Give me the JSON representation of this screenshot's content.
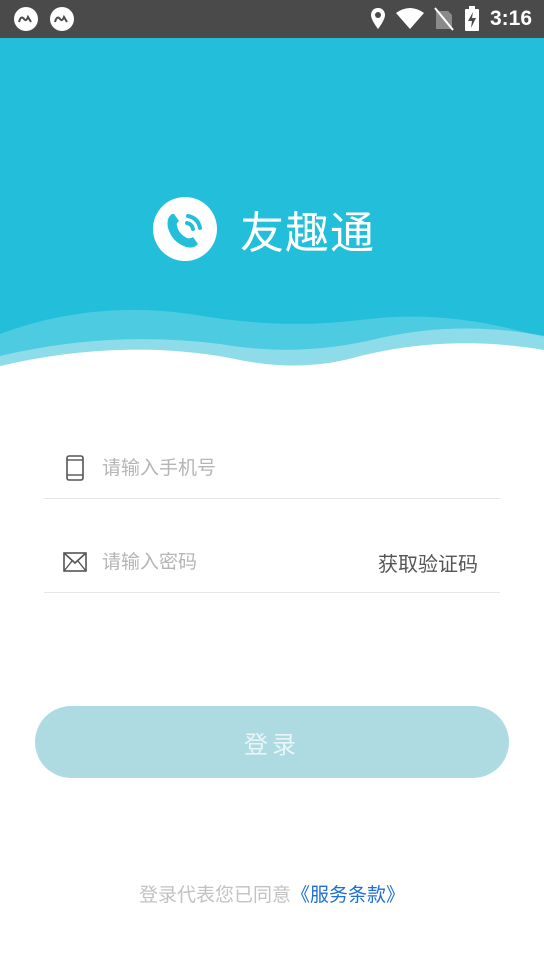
{
  "status_bar": {
    "time": "3:16",
    "apps": [
      "app-icon",
      "app-icon"
    ],
    "icons": [
      "location-icon",
      "wifi-icon",
      "no-sim-icon",
      "battery-charging-icon"
    ]
  },
  "brand": {
    "name": "友趣通",
    "logo_icon": "phone-bubble-icon",
    "hero_color": "#23bfda"
  },
  "form": {
    "phone": {
      "placeholder": "请输入手机号",
      "value": "",
      "icon": "phone-icon"
    },
    "code": {
      "placeholder": "请输入密码",
      "value": "",
      "icon": "envelope-icon",
      "action_label": "获取验证码"
    }
  },
  "login_button": {
    "label": "登录",
    "color": "#aedbe2"
  },
  "agreement": {
    "prefix": "登录代表您已同意",
    "link": "《服务条款》",
    "link_color": "#1e6fd6"
  }
}
